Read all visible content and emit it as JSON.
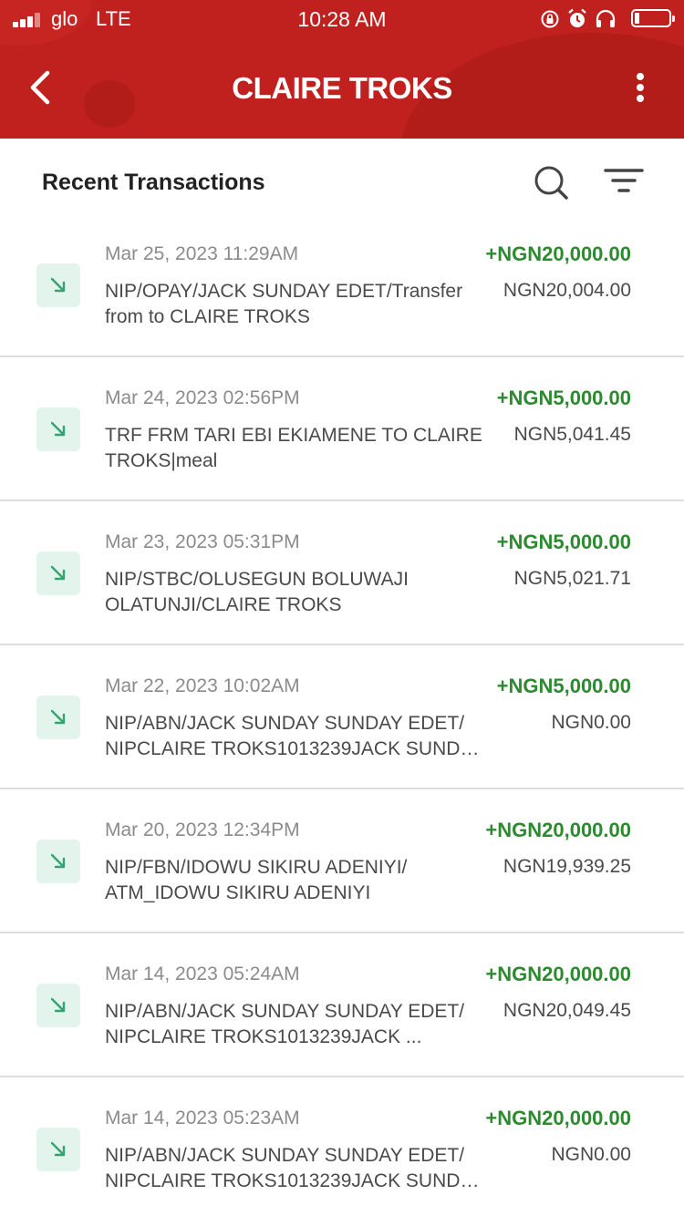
{
  "status_bar": {
    "carrier": "glo",
    "network": "LTE",
    "time": "10:28 AM"
  },
  "header": {
    "title": "CLAIRE TROKS",
    "brand_color": "#c0211e"
  },
  "section": {
    "title": "Recent Transactions"
  },
  "colors": {
    "credit_amount": "#2c8a2f",
    "credit_icon_bg": "#e3f4ec",
    "credit_icon_arrow": "#35a36f"
  },
  "transactions": [
    {
      "date": "Mar 25, 2023 11:29AM",
      "description": "NIP/OPAY/JACK SUNDAY EDET/Transfer from to CLAIRE TROKS",
      "amount": "+NGN20,000.00",
      "balance": "NGN20,004.00"
    },
    {
      "date": "Mar 24, 2023 02:56PM",
      "description": "TRF FRM TARI EBI EKIAMENE TO CLAIRE TROKS|meal",
      "amount": "+NGN5,000.00",
      "balance": "NGN5,041.45"
    },
    {
      "date": "Mar 23, 2023 05:31PM",
      "description": "NIP/STBC/OLUSEGUN BOLUWAJI OLATUNJI/CLAIRE TROKS",
      "amount": "+NGN5,000.00",
      "balance": "NGN5,021.71"
    },
    {
      "date": "Mar 22, 2023 10:02AM",
      "description": "NIP/ABN/JACK SUNDAY SUNDAY EDET/ NIPCLAIRE TROKS1013239JACK SUNDAY ...",
      "amount": "+NGN5,000.00",
      "balance": "NGN0.00"
    },
    {
      "date": "Mar 20, 2023 12:34PM",
      "description": "NIP/FBN/IDOWU SIKIRU ADENIYI/ ATM_IDOWU SIKIRU ADENIYI",
      "amount": "+NGN20,000.00",
      "balance": "NGN19,939.25"
    },
    {
      "date": "Mar 14, 2023 05:24AM",
      "description": "NIP/ABN/JACK SUNDAY SUNDAY EDET/ NIPCLAIRE TROKS1013239JACK ...",
      "amount": "+NGN20,000.00",
      "balance": "NGN20,049.45"
    },
    {
      "date": "Mar 14, 2023 05:23AM",
      "description": "NIP/ABN/JACK SUNDAY SUNDAY EDET/ NIPCLAIRE TROKS1013239JACK SUNDAY ...",
      "amount": "+NGN20,000.00",
      "balance": "NGN0.00"
    }
  ]
}
